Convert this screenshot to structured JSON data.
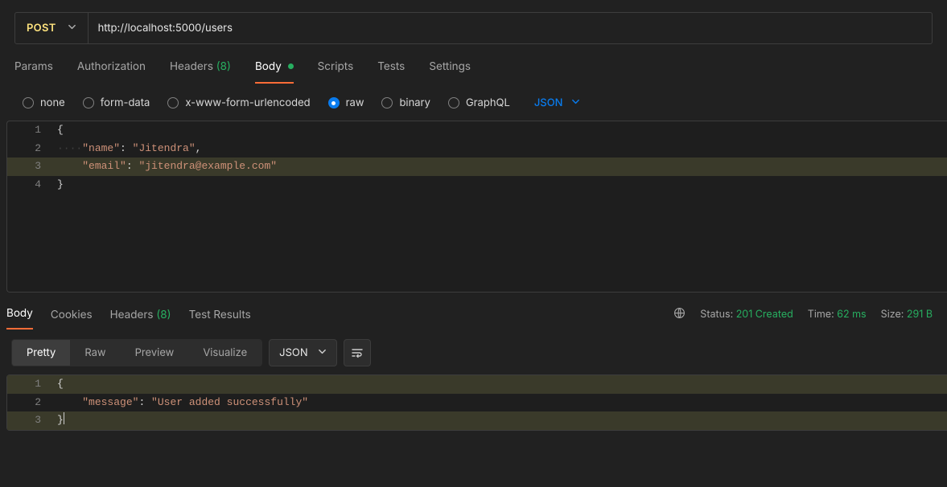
{
  "request": {
    "method": "POST",
    "url": "http://localhost:5000/users"
  },
  "tabs": {
    "params": "Params",
    "authorization": "Authorization",
    "headers": "Headers",
    "headers_count": "(8)",
    "body": "Body",
    "scripts": "Scripts",
    "tests": "Tests",
    "settings": "Settings"
  },
  "body_types": {
    "none": "none",
    "form_data": "form-data",
    "urlencoded": "x-www-form-urlencoded",
    "raw": "raw",
    "binary": "binary",
    "graphql": "GraphQL",
    "format": "JSON"
  },
  "request_body": {
    "lines": {
      "l1": "{",
      "l2_key": "\"name\"",
      "l2_val": "\"Jitendra\"",
      "l3_key": "\"email\"",
      "l3_val": "\"jitendra@example.com\"",
      "l4": "}"
    },
    "indent_dots": "····"
  },
  "response_tabs": {
    "body": "Body",
    "cookies": "Cookies",
    "headers": "Headers",
    "headers_count": "(8)",
    "test_results": "Test Results"
  },
  "response_meta": {
    "status_label": "Status:",
    "status_value": "201 Created",
    "time_label": "Time:",
    "time_value": "62 ms",
    "size_label": "Size:",
    "size_value": "291 B"
  },
  "response_toolbar": {
    "pretty": "Pretty",
    "raw": "Raw",
    "preview": "Preview",
    "visualize": "Visualize",
    "format": "JSON"
  },
  "response_body": {
    "l1": "{",
    "l2_key": "\"message\"",
    "l2_val": "\"User added successfully\"",
    "l3": "}"
  },
  "linenos": {
    "n1": "1",
    "n2": "2",
    "n3": "3",
    "n4": "4"
  }
}
